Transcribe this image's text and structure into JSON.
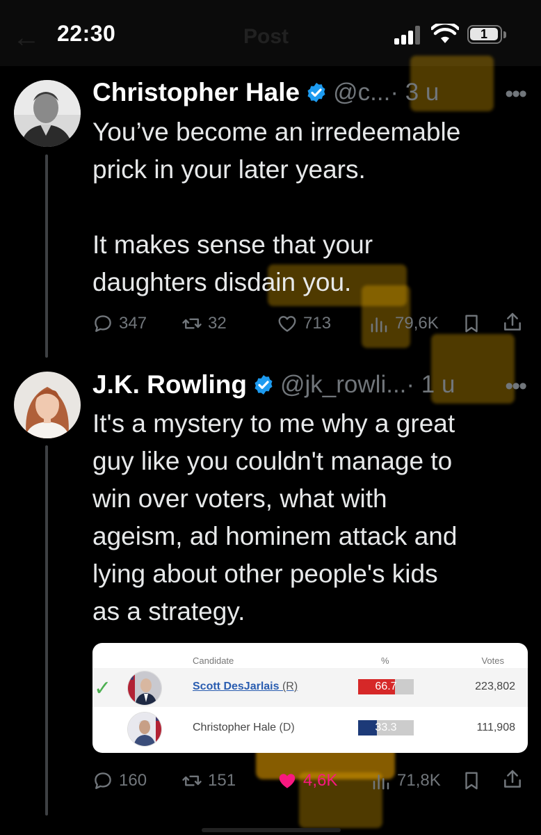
{
  "status_bar": {
    "time": "22:30",
    "battery_label": "1",
    "icons": [
      "signal-icon",
      "wifi-icon",
      "battery-icon"
    ]
  },
  "header": {
    "title": "Post",
    "back_icon": "arrow-left-icon"
  },
  "tweets": [
    {
      "author": "Christopher Hale",
      "handle": "@c...",
      "time": "· 3 u",
      "verified": true,
      "text": "You’ve become an irredeemable\nprick in your later years.\n\nIt makes sense that your\ndaughters disdain you.",
      "replies": "347",
      "reposts": "32",
      "likes": "713",
      "views": "79,6K",
      "liked": false
    },
    {
      "author": "J.K. Rowling",
      "handle": "@jk_rowli...",
      "time": "· 1 u",
      "verified": true,
      "text": "It's a mystery to me why a great\nguy like you couldn't manage to\nwin over voters, what with\nageism, ad hominem attack and\nlying about other people's kids\nas a strategy.",
      "replies": "160",
      "reposts": "151",
      "likes": "4,6K",
      "views": "71,8K",
      "liked": true
    }
  ],
  "results_card": {
    "headers": {
      "candidate": "Candidate",
      "percent": "%",
      "votes": "Votes"
    },
    "rows": [
      {
        "name": "Scott DesJarlais",
        "party": "(R)",
        "percent": 66.7,
        "percent_label": "66.7",
        "votes": "223,802",
        "winner": true,
        "bar_color": "#d62828"
      },
      {
        "name": "Christopher Hale",
        "party": "(D)",
        "percent": 33.3,
        "percent_label": "33.3",
        "votes": "111,908",
        "winner": false,
        "bar_color": "#1d3a78"
      }
    ]
  },
  "colors": {
    "background": "#000000",
    "text": "#e7e9ea",
    "muted": "#71767b",
    "verified": "#1d9bf0",
    "like": "#f91880",
    "highlight": "#f5b400"
  }
}
